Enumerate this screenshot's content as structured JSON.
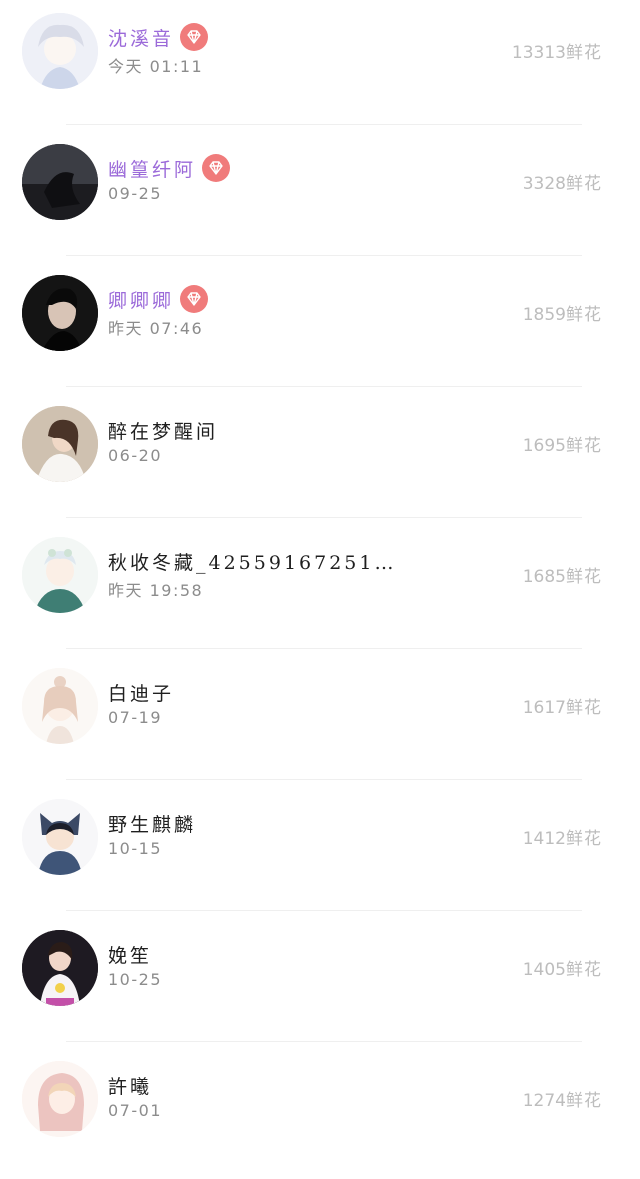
{
  "rows": [
    {
      "name": "沈溪音",
      "vip": true,
      "time": "今天 01:11",
      "count": "13313",
      "unit": "鲜花"
    },
    {
      "name": "幽篁纤阿",
      "vip": true,
      "time": "09-25",
      "count": "3328",
      "unit": "鲜花"
    },
    {
      "name": "卿卿卿",
      "vip": true,
      "time": "昨天 07:46",
      "count": "1859",
      "unit": "鲜花"
    },
    {
      "name": "醉在梦醒间",
      "vip": false,
      "time": "06-20",
      "count": "1695",
      "unit": "鲜花"
    },
    {
      "name": "秋收冬藏_42559167251…",
      "vip": false,
      "time": "昨天 19:58",
      "count": "1685",
      "unit": "鲜花"
    },
    {
      "name": "白迪子",
      "vip": false,
      "time": "07-19",
      "count": "1617",
      "unit": "鲜花"
    },
    {
      "name": "野生麒麟",
      "vip": false,
      "time": "10-15",
      "count": "1412",
      "unit": "鲜花"
    },
    {
      "name": "娩笙",
      "vip": false,
      "time": "10-25",
      "count": "1405",
      "unit": "鲜花"
    },
    {
      "name": "許曦",
      "vip": false,
      "time": "07-01",
      "count": "1274",
      "unit": "鲜花"
    }
  ],
  "colors": {
    "vip_name": "#9b6ad9",
    "badge": "#f07b7b",
    "count": "#bdbdbd",
    "time": "#8c8c8c"
  },
  "icons": {
    "badge": "diamond-icon",
    "avatar": "avatar-icon"
  }
}
